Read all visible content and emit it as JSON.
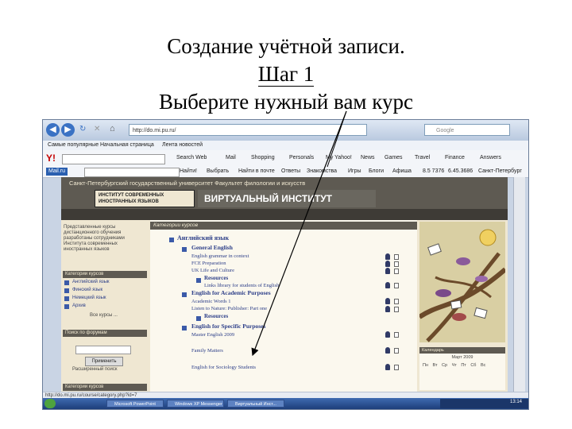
{
  "slide": {
    "line1": "Создание учётной записи.",
    "line2": "Шаг 1",
    "line3": "Выберите нужный вам курс"
  },
  "browser": {
    "address": "http://do.mi.pu.ru/",
    "search_placeholder": "Google",
    "back_icon": "back-arrow-icon",
    "forward_icon": "forward-arrow-icon",
    "bookmarks": [
      "Самые популярные",
      "Начальная страница",
      "Лента новостей"
    ],
    "yandex_toolbar": [
      "Search Web",
      "Mail",
      "Shopping",
      "Personals",
      "My Yahoo!",
      "News",
      "Games",
      "Travel",
      "Finance",
      "Answers"
    ],
    "mailru_toolbar": {
      "badge": "Mail.ru",
      "items": [
        "Найти!",
        "Выбрать",
        "Найти в почте",
        "Ответы",
        "Знакомства",
        "Игры",
        "Блоги",
        "Афиша",
        "8.5 7376",
        "6.45.3686",
        "Санкт-Петербург"
      ]
    }
  },
  "site": {
    "banner_text": "Санкт-Петербургский государственный университет   Факультет филологии и искусств",
    "institute_small": "ИНСТИТУТ СОВРЕМЕННЫХ ИНОСТРАННЫХ ЯЗЫКОВ",
    "institute_big": "ВИРТУАЛЬНЫЙ ИНСТИТУТ",
    "left": {
      "intro": [
        "Представленные курсы",
        "дистанционного обучения",
        "разработаны сотрудниками",
        "Института современных",
        "иностранных языков"
      ],
      "categories_heading": "Категории курсов",
      "categories": [
        "Английский язык",
        "Финский язык",
        "Немецкий язык",
        "Архив"
      ],
      "all_courses": "Все курсы ...",
      "search_heading": "Поиск по форумам",
      "search_button": "Применить",
      "advanced_search": "Расширенный поиск",
      "courses_heading": "Категории курсов"
    },
    "center": {
      "heading": "Категории курсов",
      "category_main": "Английский язык",
      "sub1": "General English",
      "sub1_courses": [
        "English grammar in context",
        "FCE Preparation",
        "UK Life and Culture"
      ],
      "resources": "Resources",
      "resources_course": "Links library for students of English",
      "sub2": "English for Academic Purposes",
      "sub2_courses": [
        "Academic Words 1",
        "Listen to Nature: Publisher: Part one"
      ],
      "resources2": "Resources",
      "sub3": "English for Specific Purposes",
      "sub3_courses": [
        "Master English 2009"
      ],
      "other_courses": [
        "Family Matters",
        "English for Sociology Students"
      ]
    },
    "right": {
      "calendar_heading": "Календарь",
      "calendar_month": "Март 2009",
      "calendar_days": "Пн Вт Ср Чт Пт Сб Вс"
    }
  },
  "status_bar": "http://do.mi.pu.ru/course/category.php?id=7",
  "taskbar": {
    "items": [
      "Microsoft PowerPoint",
      "Windows XP Messenger",
      "Виртуальный Инст..."
    ],
    "clock": "13:14"
  }
}
